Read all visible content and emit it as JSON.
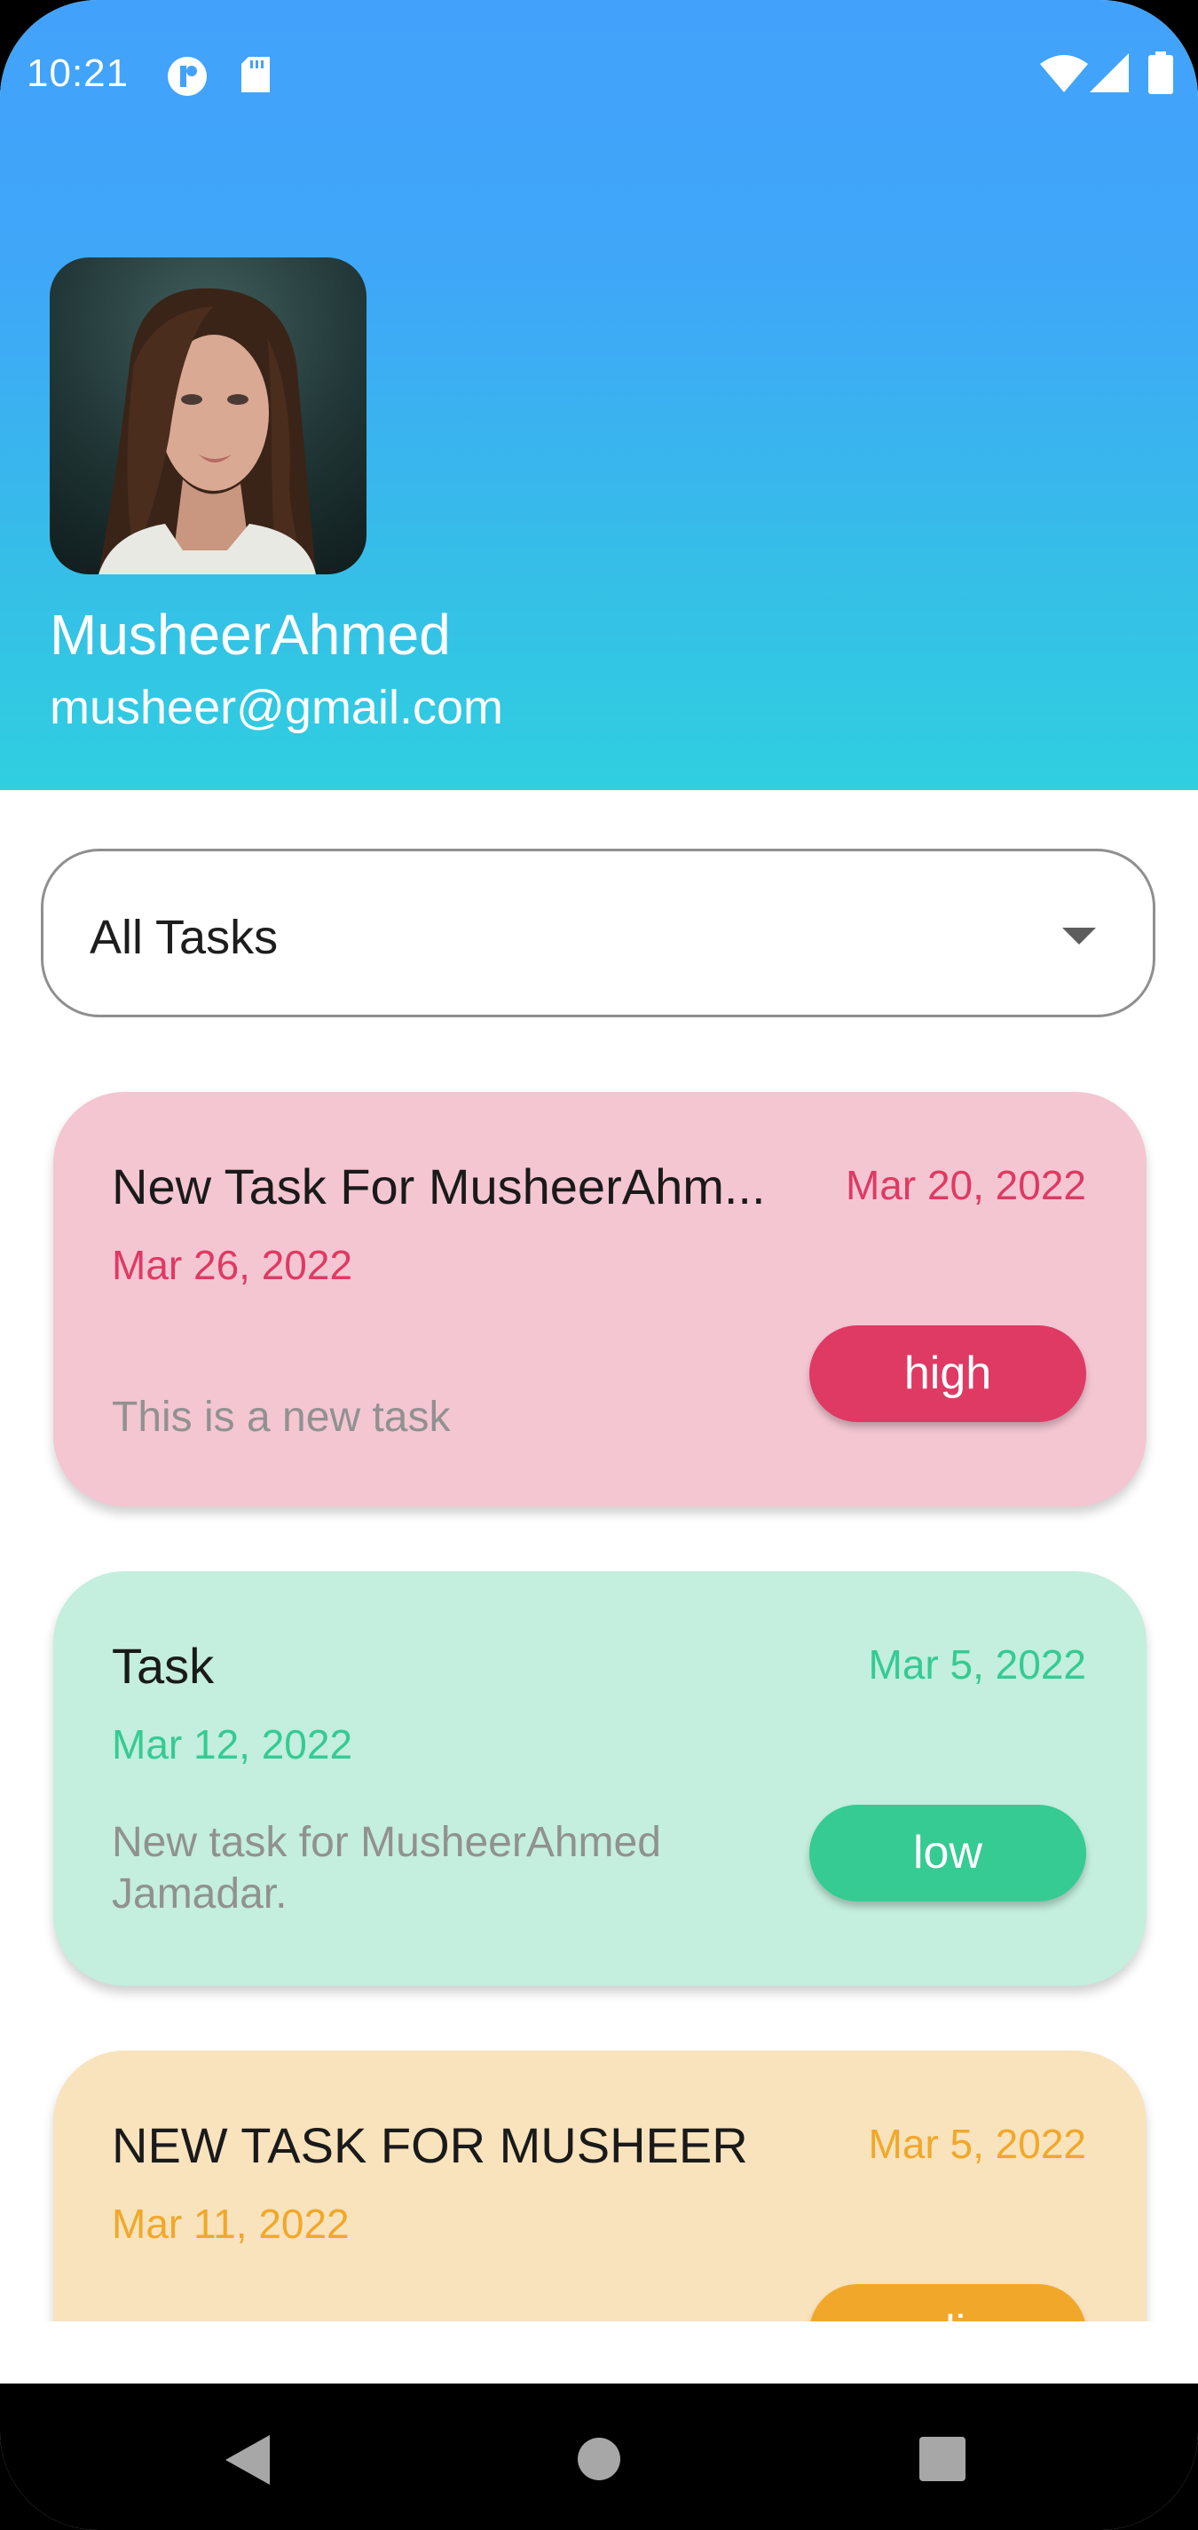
{
  "status_bar": {
    "time": "10:21",
    "left_icons": [
      "app-notification-icon",
      "sd-card-icon"
    ],
    "right_icons": [
      "wifi-icon",
      "cellular-signal-icon",
      "battery-icon"
    ]
  },
  "profile": {
    "name": "MusheerAhmed",
    "email": "musheer@gmail.com"
  },
  "filter": {
    "selected": "All Tasks"
  },
  "tasks": [
    {
      "title": "New Task For MusheerAhm...",
      "start_date": "Mar 20, 2022",
      "end_date": "Mar 26, 2022",
      "description": "This is a new task",
      "priority": "high",
      "card_color": "#f4c6d2",
      "accent_color": "#de3a64"
    },
    {
      "title": "Task",
      "start_date": "Mar 5, 2022",
      "end_date": "Mar 12, 2022",
      "description": "New task for MusheerAhmed Jamadar.",
      "priority": "low",
      "card_color": "#c4eedd",
      "accent_color": "#35cb93"
    },
    {
      "title": "NEW TASK FOR MUSHEER",
      "start_date": "Mar 5, 2022",
      "end_date": "Mar 11, 2022",
      "description": "",
      "priority": "medium",
      "card_color": "#f9e3bd",
      "accent_color": "#f1a82a"
    }
  ],
  "nav_bar": {
    "icons": [
      "back-icon",
      "home-icon",
      "recents-icon"
    ]
  }
}
